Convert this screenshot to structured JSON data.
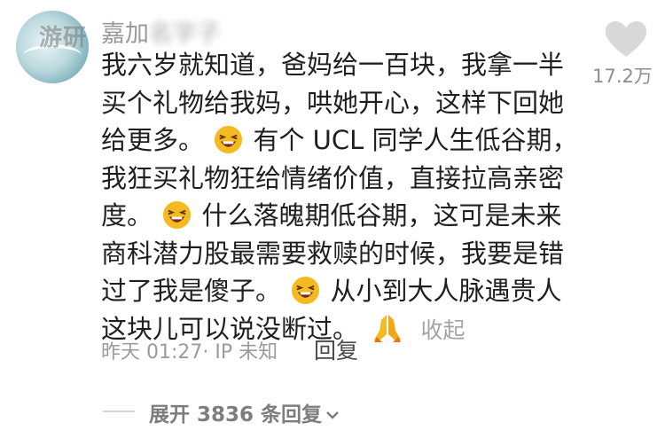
{
  "comment": {
    "author": "嘉加",
    "author_obscured": "名字子",
    "watermark": "游研",
    "like_count": "17.2万",
    "lines": [
      "我六岁就知道，爸妈给一百块，我拿一半",
      "买个礼物给我妈，哄她开心，这样下回她",
      "给更多。",
      "有个 UCL 同学人生低谷期，",
      "我狂买礼物狂给情绪价值，直接拉高亲密",
      "度。",
      "什么落魄期低谷期，这可是未来",
      "商科潜力股最需要救赎的时候，我要是错",
      "过了我是傻子。",
      "从小到大人脉遇贵人",
      "这块儿可以说没断过。"
    ],
    "collapse_label": "收起",
    "time": "昨天 01:27",
    "location": "· IP 未知",
    "reply_label": "回复",
    "expand_label": "展开 3836 条回复",
    "icons": {
      "like": "heart-icon",
      "emoji_laugh": "laughing-face-emoji",
      "emoji_pray": "praying-hands-emoji",
      "expand": "chevron-down-icon"
    },
    "colors": {
      "text": "#1f1f1f",
      "meta": "#9b9b9b",
      "heart": "#d9d9d9",
      "emoji": "#f5b921"
    }
  }
}
